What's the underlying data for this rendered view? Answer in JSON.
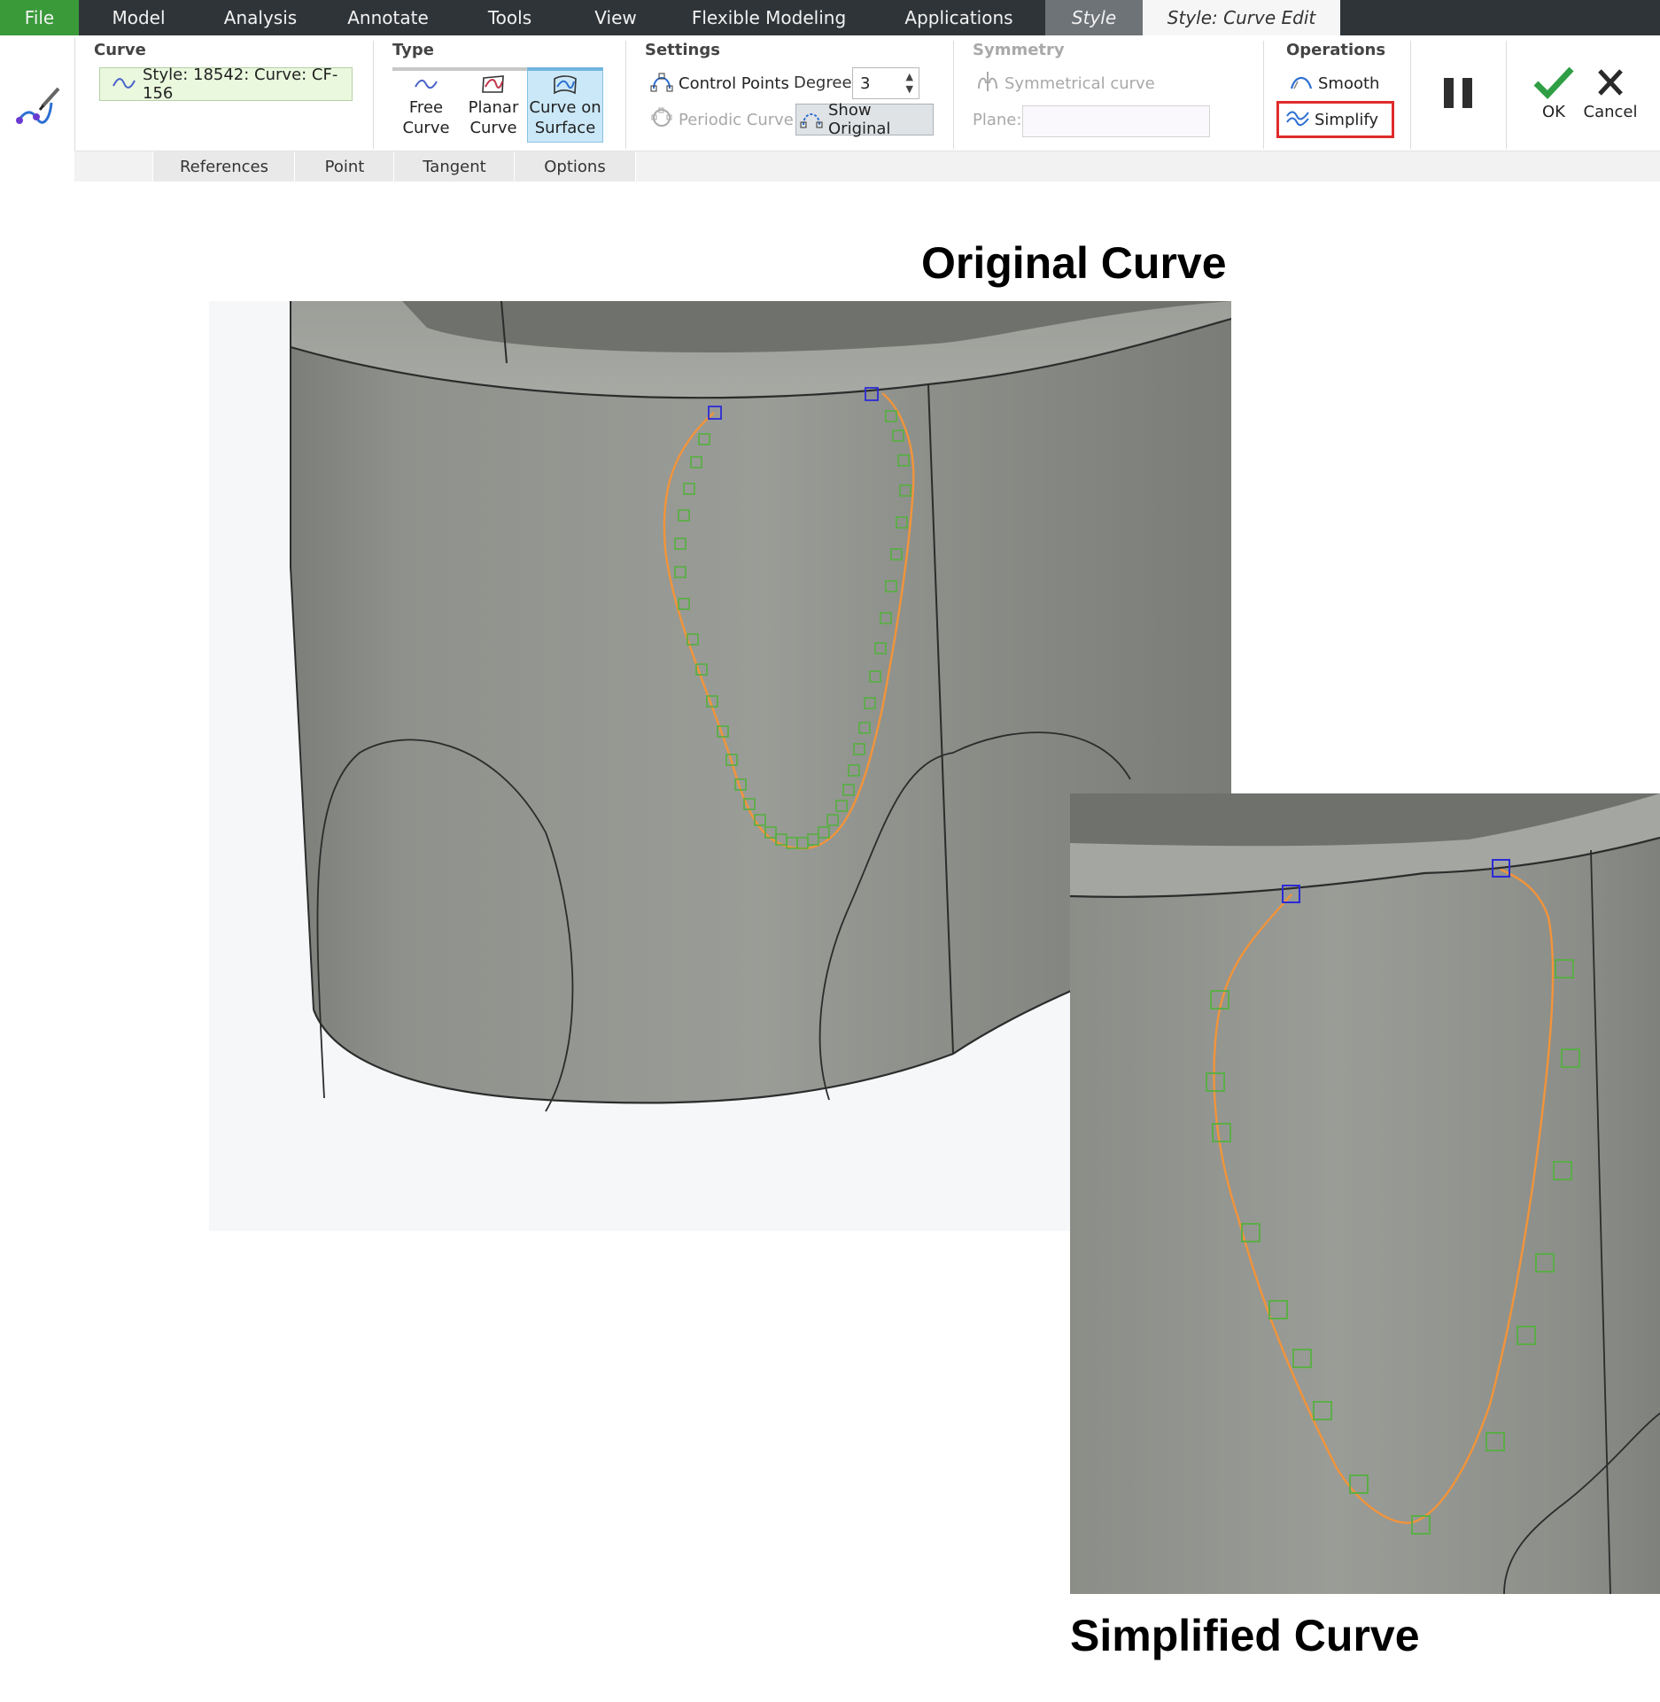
{
  "menu": {
    "tabs": [
      {
        "label": "File"
      },
      {
        "label": "Model"
      },
      {
        "label": "Analysis"
      },
      {
        "label": "Annotate"
      },
      {
        "label": "Tools"
      },
      {
        "label": "View"
      },
      {
        "label": "Flexible Modeling"
      },
      {
        "label": "Applications"
      },
      {
        "label": "Style"
      },
      {
        "label": "Style: Curve Edit"
      }
    ]
  },
  "ribbon": {
    "curve": {
      "title": "Curve",
      "value": "Style: 18542: Curve: CF-156"
    },
    "type": {
      "title": "Type",
      "free_curve": {
        "line1": "Free",
        "line2": "Curve"
      },
      "planar_curve": {
        "line1": "Planar",
        "line2": "Curve"
      },
      "curve_on_surface": {
        "line1": "Curve on",
        "line2": "Surface"
      }
    },
    "settings": {
      "title": "Settings",
      "control_points": "Control Points",
      "degree_label": "Degree:",
      "degree_value": "3",
      "periodic_curve": "Periodic Curve",
      "show_original": "Show Original"
    },
    "symmetry": {
      "title": "Symmetry",
      "symmetrical_curve": "Symmetrical curve",
      "plane_label": "Plane:",
      "plane_value": ""
    },
    "operations": {
      "title": "Operations",
      "smooth": "Smooth",
      "simplify": "Simplify"
    },
    "ok": "OK",
    "cancel": "Cancel",
    "subtabs": [
      {
        "label": "References"
      },
      {
        "label": "Point"
      },
      {
        "label": "Tangent"
      },
      {
        "label": "Options"
      }
    ]
  },
  "headings": {
    "original": "Original Curve",
    "simplified": "Simplified Curve"
  },
  "colors": {
    "menubar": "#2f3438",
    "file_tab": "#3a9a3a",
    "curve_orange": "#f2943a",
    "control_point_green": "#55b040",
    "endpoint_blue": "#2b2bd6",
    "highlight_red": "#e02b2b",
    "surface_gray": "#8f918c"
  },
  "icons": {
    "sketch": "curve-sketch-icon",
    "curve": "wave-icon",
    "free": "free-curve-icon",
    "planar": "planar-curve-icon",
    "surface": "curve-on-surface-icon",
    "control": "control-points-icon",
    "periodic": "periodic-curve-icon",
    "show": "show-original-icon",
    "symm": "symmetrical-curve-icon",
    "smooth": "smooth-icon",
    "simplify": "simplify-icon",
    "pause": "pause-icon",
    "ok": "checkmark-icon",
    "cancel": "x-icon"
  }
}
